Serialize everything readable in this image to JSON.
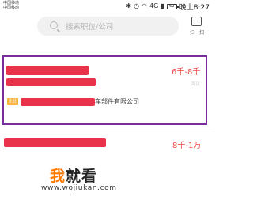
{
  "status_bar": {
    "carrier_1": "中国移动",
    "carrier_2": "中国移动",
    "network": "4G",
    "battery": "62",
    "time": "晚上8:27"
  },
  "search": {
    "placeholder": "搜索职位/公司",
    "scan_label": "扫一扫"
  },
  "jobs": [
    {
      "salary": "6千-8千",
      "tag": "面议",
      "company_badge": "企业",
      "company_suffix": "车部件有限公司",
      "highlighted": true
    },
    {
      "salary": "8千-1万"
    }
  ],
  "watermark": {
    "title_part1": "我",
    "title_part2": "就看",
    "url": "www.wojiukan.com"
  },
  "colors": {
    "salary": "#ef4a47",
    "redaction": "#e8334a",
    "highlight_border": "#7b2d9e",
    "badge": "#f7b33c"
  }
}
